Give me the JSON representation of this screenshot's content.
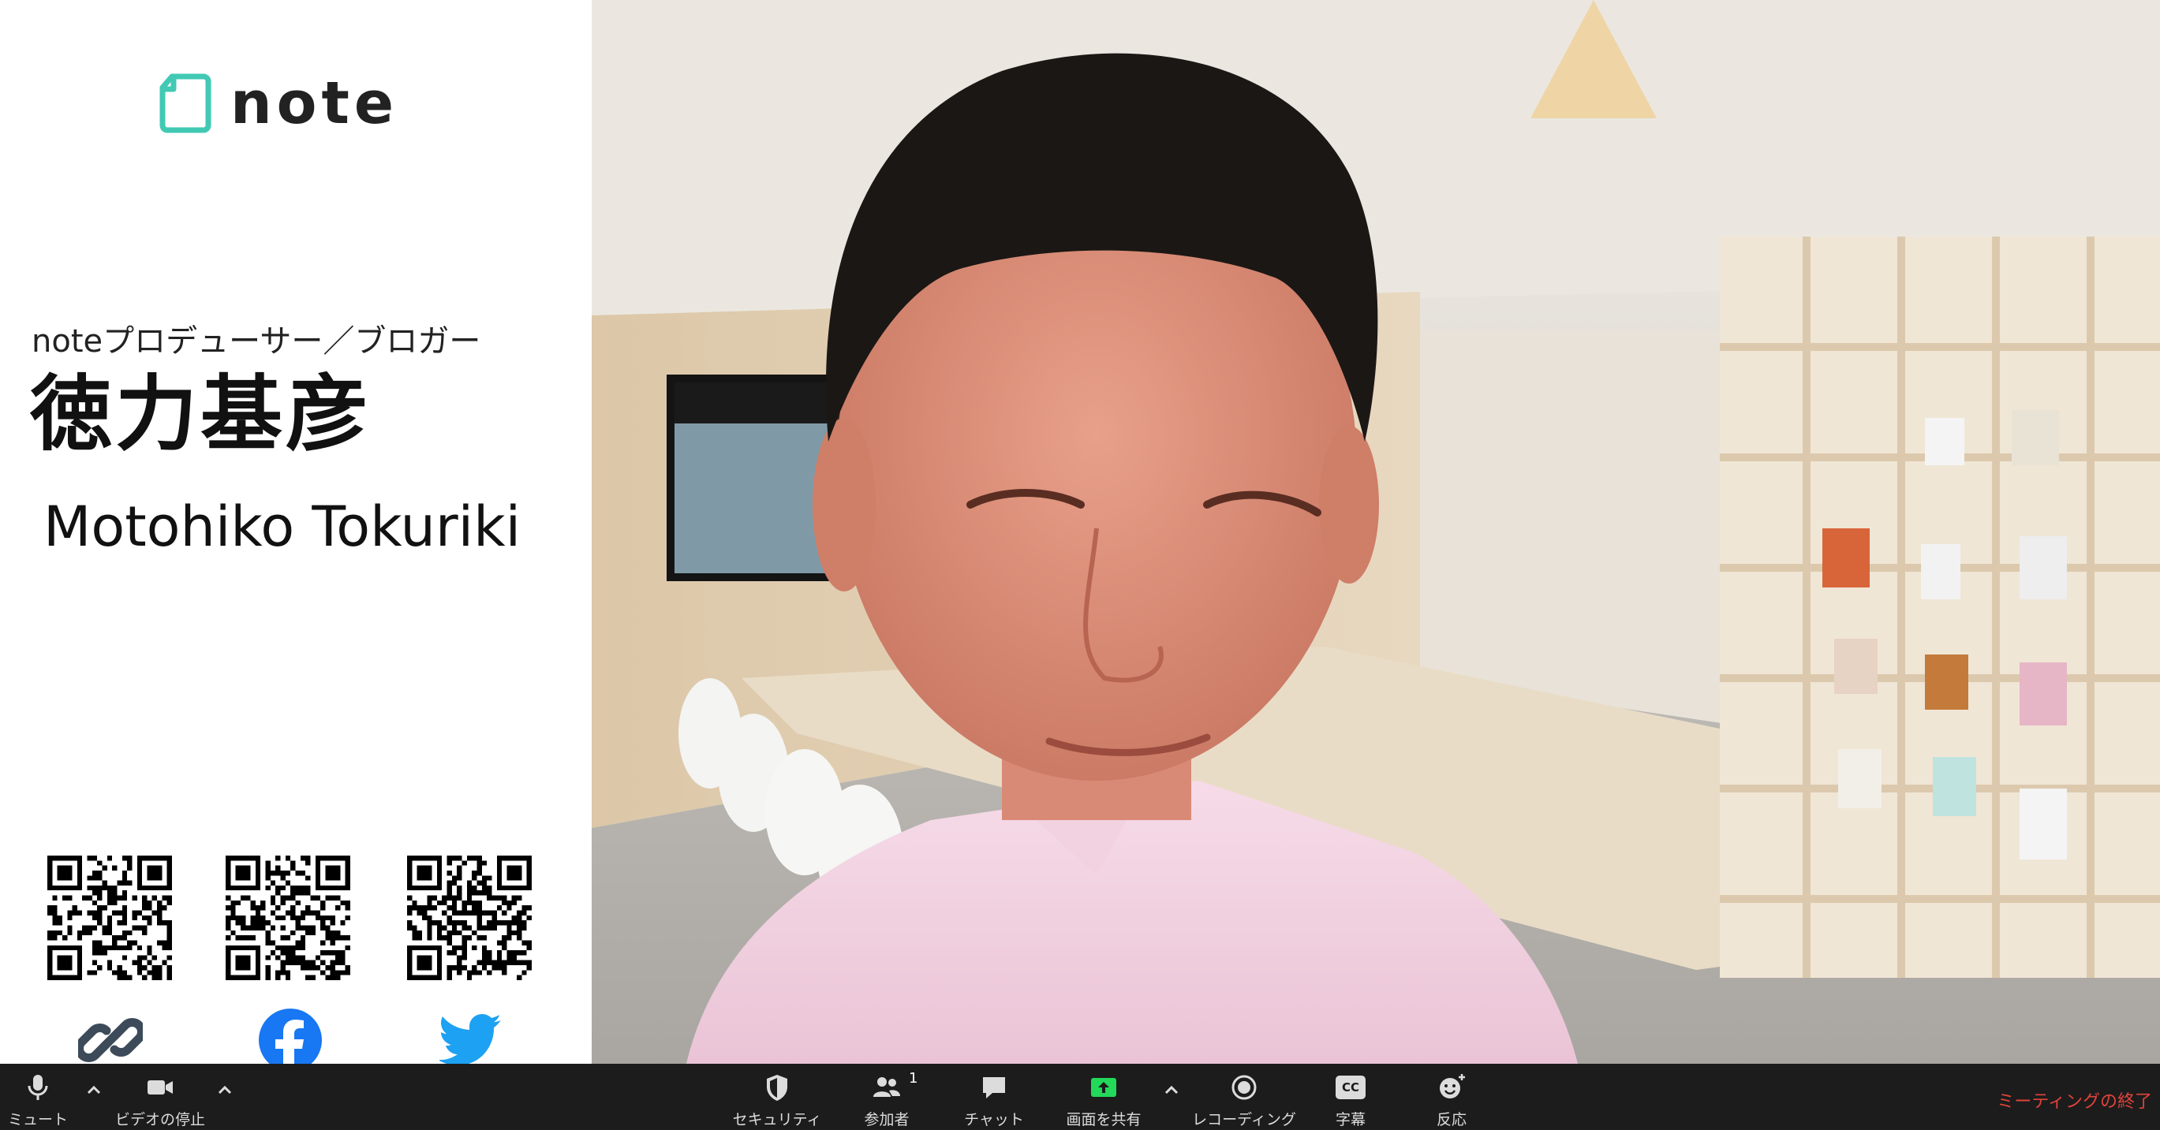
{
  "card": {
    "logo_text": "note",
    "role": "noteプロデューサー／ブロガー",
    "name_ja": "徳力基彦",
    "name_en": "Motohiko Tokuriki"
  },
  "colors": {
    "logo_accent": "#41c9b4",
    "facebook": "#1877f2",
    "twitter": "#1da1f2",
    "link_icon": "#3c4a5a",
    "share_green": "#23d959",
    "end_meeting": "#e0433a",
    "toolbar_bg": "#1c1c1c"
  },
  "icons": {
    "link": "link-icon",
    "facebook": "facebook-icon",
    "twitter": "twitter-icon"
  },
  "toolbar": {
    "mute_label": "ミュート",
    "video_label": "ビデオの停止",
    "security_label": "セキュリティ",
    "participants_label": "参加者",
    "participants_count": "1",
    "chat_label": "チャット",
    "share_label": "画面を共有",
    "record_label": "レコーディング",
    "cc_label": "字幕",
    "cc_badge": "CC",
    "reactions_label": "反応",
    "end_label": "ミーティングの終了"
  }
}
